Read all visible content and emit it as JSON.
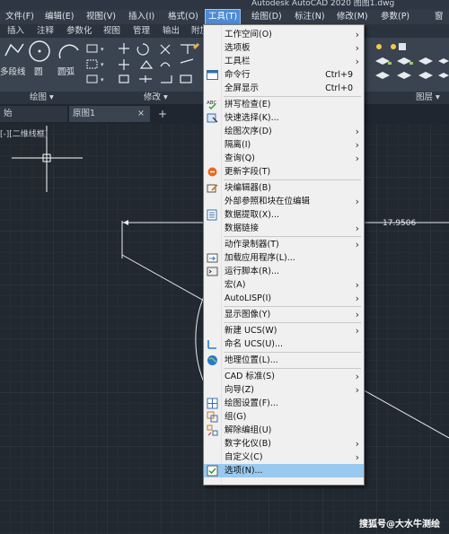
{
  "app_title": "Autodesk AutoCAD 2020   图图1.dwg",
  "menubar": [
    "文件(F)",
    "编辑(E)",
    "视图(V)",
    "插入(I)",
    "格式(O)",
    "工具(T)",
    "绘图(D)",
    "标注(N)",
    "修改(M)",
    "参数(P)",
    "窗"
  ],
  "ribbon_tabs": [
    "插入",
    "注释",
    "参数化",
    "视图",
    "管理",
    "输出",
    "附加"
  ],
  "ribbon": {
    "tools": [
      "多段线",
      "圆",
      "圆弧"
    ],
    "panels": [
      "绘图 ▾",
      "修改 ▾",
      "图层 ▾"
    ]
  },
  "doc_tabs": [
    {
      "label": "始"
    },
    {
      "label": "原图1",
      "close": "×"
    },
    {
      "label": "+"
    }
  ],
  "view_label": "[-][二维线框]",
  "dimension_value": "17.9506",
  "watermark": "搜狐号@大水牛测绘",
  "tools_menu": [
    {
      "label": "工作空间(O)",
      "submenu": true
    },
    {
      "label": "选项板",
      "submenu": true
    },
    {
      "label": "工具栏",
      "submenu": true
    },
    {
      "label": "命令行",
      "shortcut": "Ctrl+9",
      "icon": "command-line-icon"
    },
    {
      "label": "全屏显示",
      "shortcut": "Ctrl+0"
    },
    {
      "sep": true
    },
    {
      "label": "拼写检查(E)",
      "icon": "spell-check-icon"
    },
    {
      "label": "快速选择(K)...",
      "icon": "quick-select-icon"
    },
    {
      "label": "绘图次序(D)",
      "submenu": true
    },
    {
      "label": "隔离(I)",
      "submenu": true
    },
    {
      "label": "查询(Q)",
      "submenu": true
    },
    {
      "label": "更新字段(T)",
      "icon": "update-field-icon"
    },
    {
      "sep": true
    },
    {
      "label": "块编辑器(B)",
      "icon": "block-editor-icon"
    },
    {
      "label": "外部参照和块在位编辑",
      "submenu": true
    },
    {
      "label": "数据提取(X)...",
      "icon": "data-extraction-icon"
    },
    {
      "label": "数据链接",
      "submenu": true
    },
    {
      "sep": true
    },
    {
      "label": "动作录制器(T)",
      "submenu": true
    },
    {
      "label": "加载应用程序(L)...",
      "icon": "load-app-icon"
    },
    {
      "label": "运行脚本(R)...",
      "icon": "run-script-icon"
    },
    {
      "label": "宏(A)",
      "submenu": true
    },
    {
      "label": "AutoLISP(I)",
      "submenu": true
    },
    {
      "sep": true
    },
    {
      "label": "显示图像(Y)",
      "submenu": true
    },
    {
      "sep": true
    },
    {
      "label": "新建 UCS(W)",
      "submenu": true
    },
    {
      "label": "命名 UCS(U)...",
      "icon": "named-ucs-icon"
    },
    {
      "sep": true
    },
    {
      "label": "地理位置(L)...",
      "icon": "geolocation-icon"
    },
    {
      "sep": true
    },
    {
      "label": "CAD 标准(S)",
      "submenu": true
    },
    {
      "label": "向导(Z)",
      "submenu": true
    },
    {
      "label": "绘图设置(F)...",
      "icon": "drafting-settings-icon"
    },
    {
      "label": "组(G)",
      "icon": "group-icon"
    },
    {
      "label": "解除编组(U)",
      "icon": "ungroup-icon"
    },
    {
      "label": "数字化仪(B)",
      "submenu": true
    },
    {
      "label": "自定义(C)",
      "submenu": true
    },
    {
      "label": "选项(N)...",
      "icon": "options-icon",
      "highlighted": true
    }
  ],
  "colors": {
    "menu_highlight": "#99c9ef",
    "active_menu": "#4c8bd6",
    "canvas": "#212830"
  }
}
